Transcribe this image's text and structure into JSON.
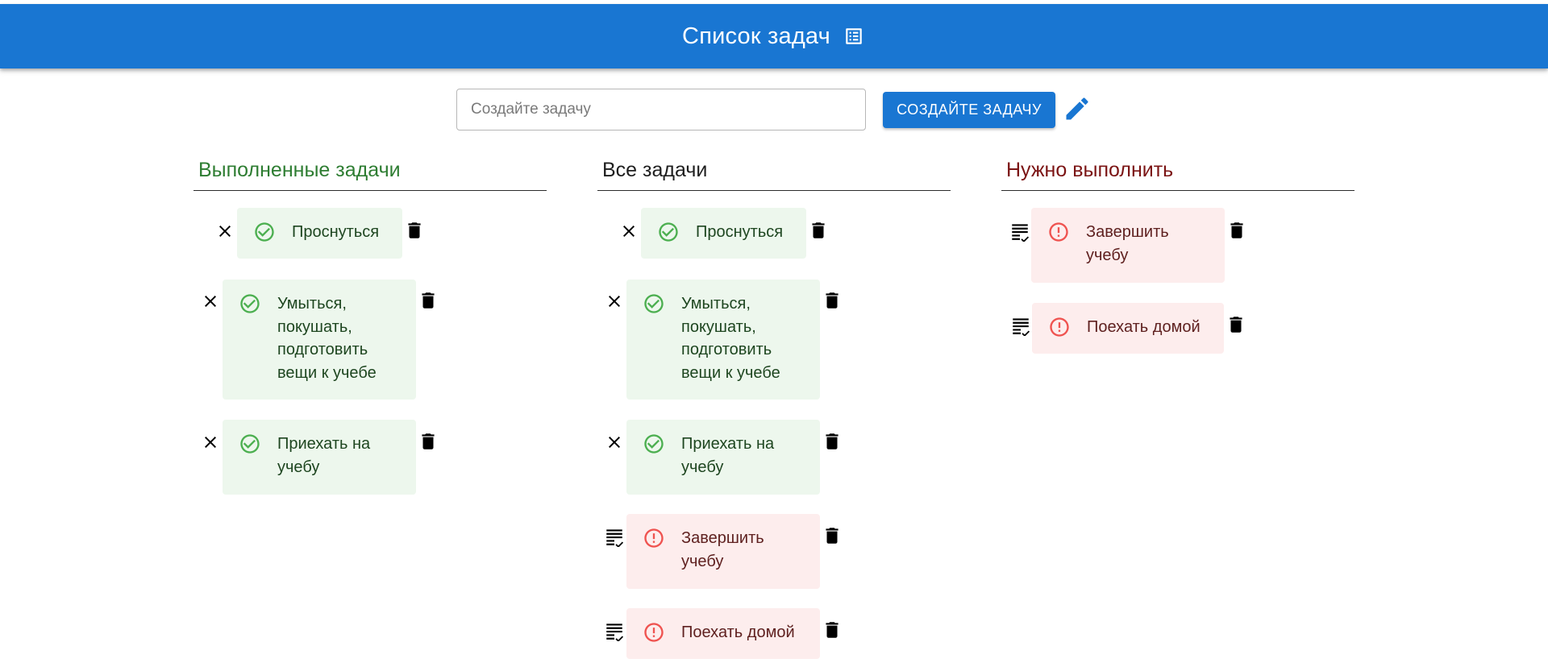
{
  "header": {
    "title": "Список задач",
    "icon": "list-alt-icon"
  },
  "create": {
    "placeholder": "Создайте задачу",
    "button_label": "СОЗДАЙТЕ ЗАДАЧУ",
    "edit_icon": "pencil-icon"
  },
  "colors": {
    "primary": "#1976d2",
    "done_bg": "#edf7ed",
    "done_text": "#1e4620",
    "done_icon": "#4caf50",
    "todo_bg": "#fdeded",
    "todo_text": "#5f2120",
    "todo_icon": "#ef5350",
    "done_header": "#2e7d32",
    "todo_header": "#7b1414"
  },
  "columns": {
    "done": {
      "title": "Выполненные задачи",
      "tasks": [
        {
          "text": "Проснуться",
          "status": "done"
        },
        {
          "text": "Умыться, покушать, подготовить вещи к учебе",
          "status": "done"
        },
        {
          "text": "Приехать на учебу",
          "status": "done"
        }
      ]
    },
    "all": {
      "title": "Все задачи",
      "tasks": [
        {
          "text": "Проснуться",
          "status": "done"
        },
        {
          "text": "Умыться, покушать, подготовить вещи к учебе",
          "status": "done"
        },
        {
          "text": "Приехать на учебу",
          "status": "done"
        },
        {
          "text": "Завершить учебу",
          "status": "todo"
        },
        {
          "text": "Поехать домой",
          "status": "todo"
        }
      ]
    },
    "todo": {
      "title": "Нужно выполнить",
      "tasks": [
        {
          "text": "Завершить учебу",
          "status": "todo"
        },
        {
          "text": "Поехать домой",
          "status": "todo"
        }
      ]
    }
  }
}
